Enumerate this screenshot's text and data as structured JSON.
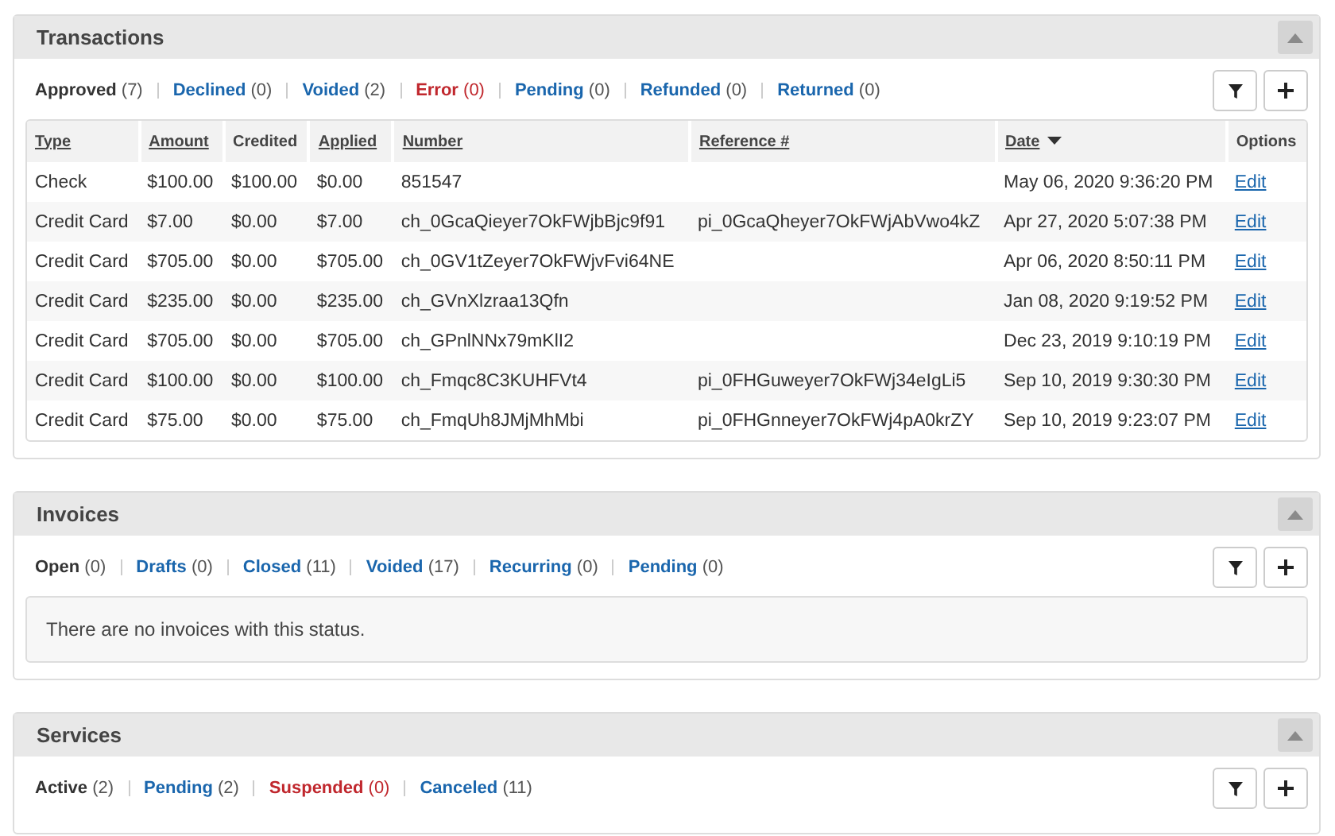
{
  "panels": [
    {
      "title": "Transactions",
      "filters": [
        {
          "label": "Approved",
          "count": "(7)",
          "selected": true,
          "kind": "normal"
        },
        {
          "label": "Declined",
          "count": "(0)",
          "selected": false,
          "kind": "normal"
        },
        {
          "label": "Voided",
          "count": "(2)",
          "selected": false,
          "kind": "normal"
        },
        {
          "label": "Error",
          "count": "(0)",
          "selected": false,
          "kind": "alert"
        },
        {
          "label": "Pending",
          "count": "(0)",
          "selected": false,
          "kind": "normal"
        },
        {
          "label": "Refunded",
          "count": "(0)",
          "selected": false,
          "kind": "normal"
        },
        {
          "label": "Returned",
          "count": "(0)",
          "selected": false,
          "kind": "normal"
        }
      ],
      "table": {
        "columns": [
          {
            "label": "Type",
            "sortable": true,
            "sorted": false
          },
          {
            "label": "Amount",
            "sortable": true,
            "sorted": false
          },
          {
            "label": "Credited",
            "sortable": false,
            "sorted": false
          },
          {
            "label": "Applied",
            "sortable": true,
            "sorted": false
          },
          {
            "label": "Number",
            "sortable": true,
            "sorted": false
          },
          {
            "label": "Reference #",
            "sortable": true,
            "sorted": false
          },
          {
            "label": "Date",
            "sortable": true,
            "sorted": true
          },
          {
            "label": "Options",
            "sortable": false,
            "sorted": false
          }
        ],
        "rows": [
          {
            "cells": [
              "Check",
              "$100.00",
              "$100.00",
              "$0.00",
              "851547",
              "",
              "May 06, 2020 9:36:20 PM"
            ],
            "action": "Edit"
          },
          {
            "cells": [
              "Credit Card",
              "$7.00",
              "$0.00",
              "$7.00",
              "ch_0GcaQieyer7OkFWjbBjc9f91",
              "pi_0GcaQheyer7OkFWjAbVwo4kZ",
              "Apr 27, 2020 5:07:38 PM"
            ],
            "action": "Edit"
          },
          {
            "cells": [
              "Credit Card",
              "$705.00",
              "$0.00",
              "$705.00",
              "ch_0GV1tZeyer7OkFWjvFvi64NE",
              "",
              "Apr 06, 2020 8:50:11 PM"
            ],
            "action": "Edit"
          },
          {
            "cells": [
              "Credit Card",
              "$235.00",
              "$0.00",
              "$235.00",
              "ch_GVnXlzraa13Qfn",
              "",
              "Jan 08, 2020 9:19:52 PM"
            ],
            "action": "Edit"
          },
          {
            "cells": [
              "Credit Card",
              "$705.00",
              "$0.00",
              "$705.00",
              "ch_GPnlNNx79mKlI2",
              "",
              "Dec 23, 2019 9:10:19 PM"
            ],
            "action": "Edit"
          },
          {
            "cells": [
              "Credit Card",
              "$100.00",
              "$0.00",
              "$100.00",
              "ch_Fmqc8C3KUHFVt4",
              "pi_0FHGuweyer7OkFWj34eIgLi5",
              "Sep 10, 2019 9:30:30 PM"
            ],
            "action": "Edit"
          },
          {
            "cells": [
              "Credit Card",
              "$75.00",
              "$0.00",
              "$75.00",
              "ch_FmqUh8JMjMhMbi",
              "pi_0FHGnneyer7OkFWj4pA0krZY",
              "Sep 10, 2019 9:23:07 PM"
            ],
            "action": "Edit"
          }
        ]
      }
    },
    {
      "title": "Invoices",
      "filters": [
        {
          "label": "Open",
          "count": "(0)",
          "selected": true,
          "kind": "normal"
        },
        {
          "label": "Drafts",
          "count": "(0)",
          "selected": false,
          "kind": "normal"
        },
        {
          "label": "Closed",
          "count": "(11)",
          "selected": false,
          "kind": "normal"
        },
        {
          "label": "Voided",
          "count": "(17)",
          "selected": false,
          "kind": "normal"
        },
        {
          "label": "Recurring",
          "count": "(0)",
          "selected": false,
          "kind": "normal"
        },
        {
          "label": "Pending",
          "count": "(0)",
          "selected": false,
          "kind": "normal"
        }
      ],
      "empty_message": "There are no invoices with this status."
    },
    {
      "title": "Services",
      "filters": [
        {
          "label": "Active",
          "count": "(2)",
          "selected": true,
          "kind": "normal"
        },
        {
          "label": "Pending",
          "count": "(2)",
          "selected": false,
          "kind": "normal"
        },
        {
          "label": "Suspended",
          "count": "(0)",
          "selected": false,
          "kind": "alert"
        },
        {
          "label": "Canceled",
          "count": "(11)",
          "selected": false,
          "kind": "normal"
        }
      ]
    }
  ]
}
